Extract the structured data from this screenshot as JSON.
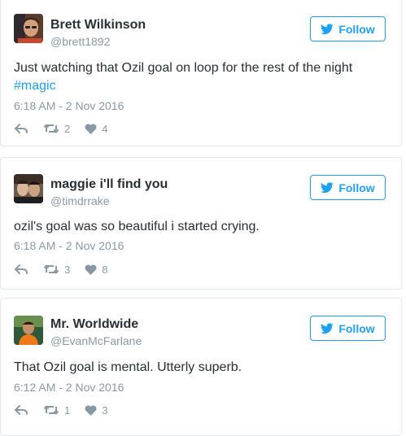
{
  "follow_label": "Follow",
  "colors": {
    "accent": "#1da1f2",
    "text": "#292f33",
    "muted": "#8899a6",
    "border": "#e1e8ed"
  },
  "tweets": [
    {
      "name": "Brett Wilkinson",
      "handle": "@brett1892",
      "text": "Just watching that Ozil goal on loop for the rest of the night",
      "hashtag": "#magic",
      "timestamp": "6:18 AM - 2 Nov 2016",
      "retweets": "2",
      "likes": "4"
    },
    {
      "name": "maggie i'll find you",
      "handle": "@timdrrake",
      "text": "ozil's goal was so beautiful i started crying.",
      "timestamp": "6:18 AM - 2 Nov 2016",
      "retweets": "3",
      "likes": "8"
    },
    {
      "name": "Mr. Worldwide",
      "handle": "@EvanMcFarlane",
      "text": "That Ozil goal is mental. Utterly superb.",
      "timestamp": "6:12 AM - 2 Nov 2016",
      "retweets": "1",
      "likes": "3"
    }
  ]
}
